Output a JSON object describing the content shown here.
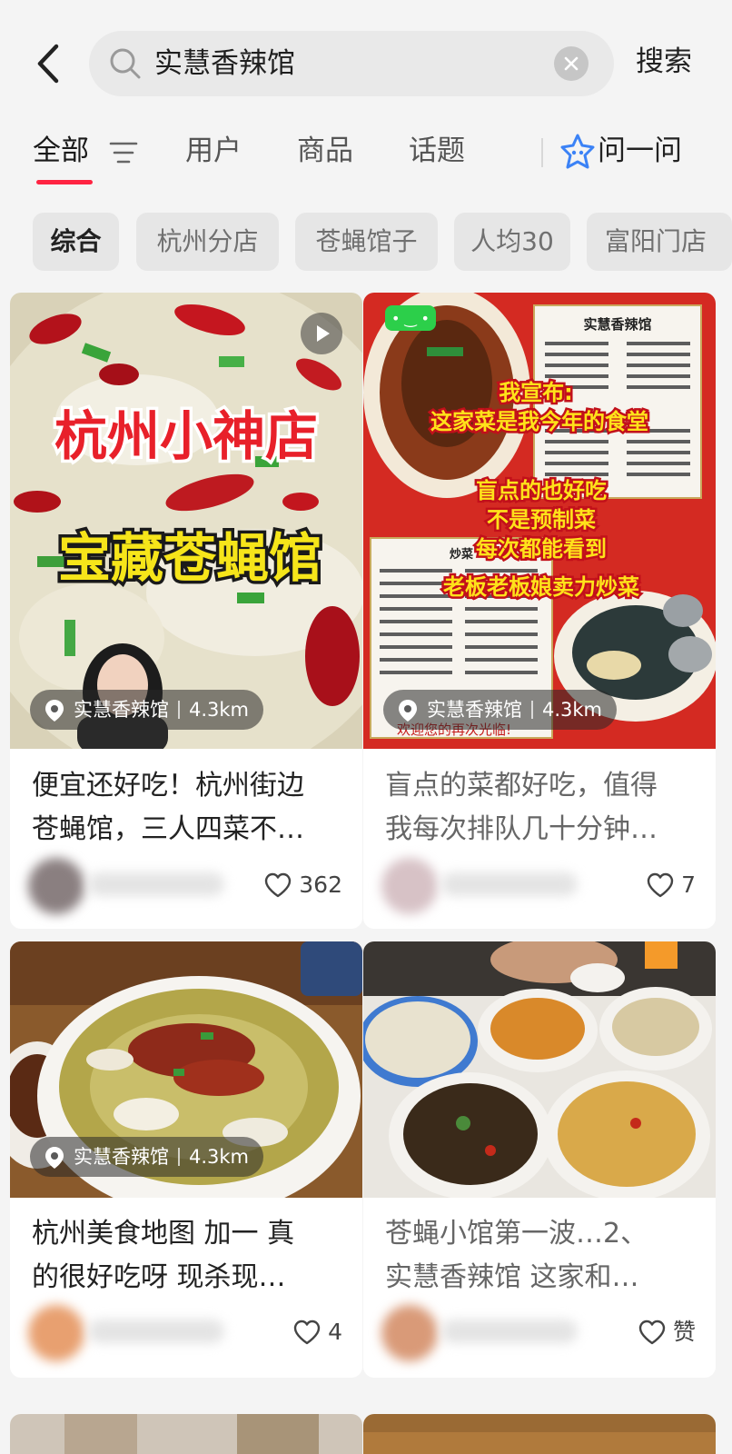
{
  "search": {
    "query": "实慧香辣馆",
    "submit_label": "搜索"
  },
  "tabs": [
    {
      "label": "全部",
      "active": true
    },
    {
      "label": "用户"
    },
    {
      "label": "商品"
    },
    {
      "label": "话题"
    },
    {
      "label": "问一问"
    }
  ],
  "chips": [
    {
      "label": "综合",
      "active": true
    },
    {
      "label": "杭州分店"
    },
    {
      "label": "苍蝇馆子"
    },
    {
      "label": "人均30"
    },
    {
      "label": "富阳门店"
    }
  ],
  "colors": {
    "accent": "#ff2442",
    "background": "#f4f4f4"
  },
  "cards": [
    {
      "overlay_lines": [
        "杭州小神店",
        "宝藏苍蝇馆"
      ],
      "location": "实慧香辣馆",
      "distance": "4.3km",
      "title_lines": [
        "便宜还好吃！杭州街边",
        "苍蝇馆，三人四菜不…"
      ],
      "likes": "362",
      "has_video": true
    },
    {
      "overlay_lines": [
        "我宣布:",
        "这家菜是我今年的食堂",
        "盲点的也好吃",
        "不是预制菜",
        "每次都能看到",
        "老板老板娘卖力炒菜"
      ],
      "menu_title": "实慧香辣馆",
      "menu_section": "炒菜",
      "footer_text": "欢迎您的再次光临!",
      "location": "实慧香辣馆",
      "distance": "4.3km",
      "title_lines": [
        "盲点的菜都好吃，值得",
        "我每次排队几十分钟…"
      ],
      "likes": "7"
    },
    {
      "location": "实慧香辣馆",
      "distance": "4.3km",
      "title_lines": [
        "杭州美食地图 加一 真",
        "的很好吃呀 现杀现…"
      ],
      "likes": "4"
    },
    {
      "title_lines": [
        "苍蝇小馆第一波…2、",
        "实慧香辣馆 这家和…"
      ],
      "likes": "赞"
    }
  ],
  "icons": {
    "back": "chevron-left-icon",
    "search": "search-icon",
    "clear": "close-icon",
    "filter": "filter-lines-icon",
    "ask": "sparkle-star-icon",
    "location": "location-pin-icon",
    "like": "heart-icon",
    "play": "play-icon"
  }
}
